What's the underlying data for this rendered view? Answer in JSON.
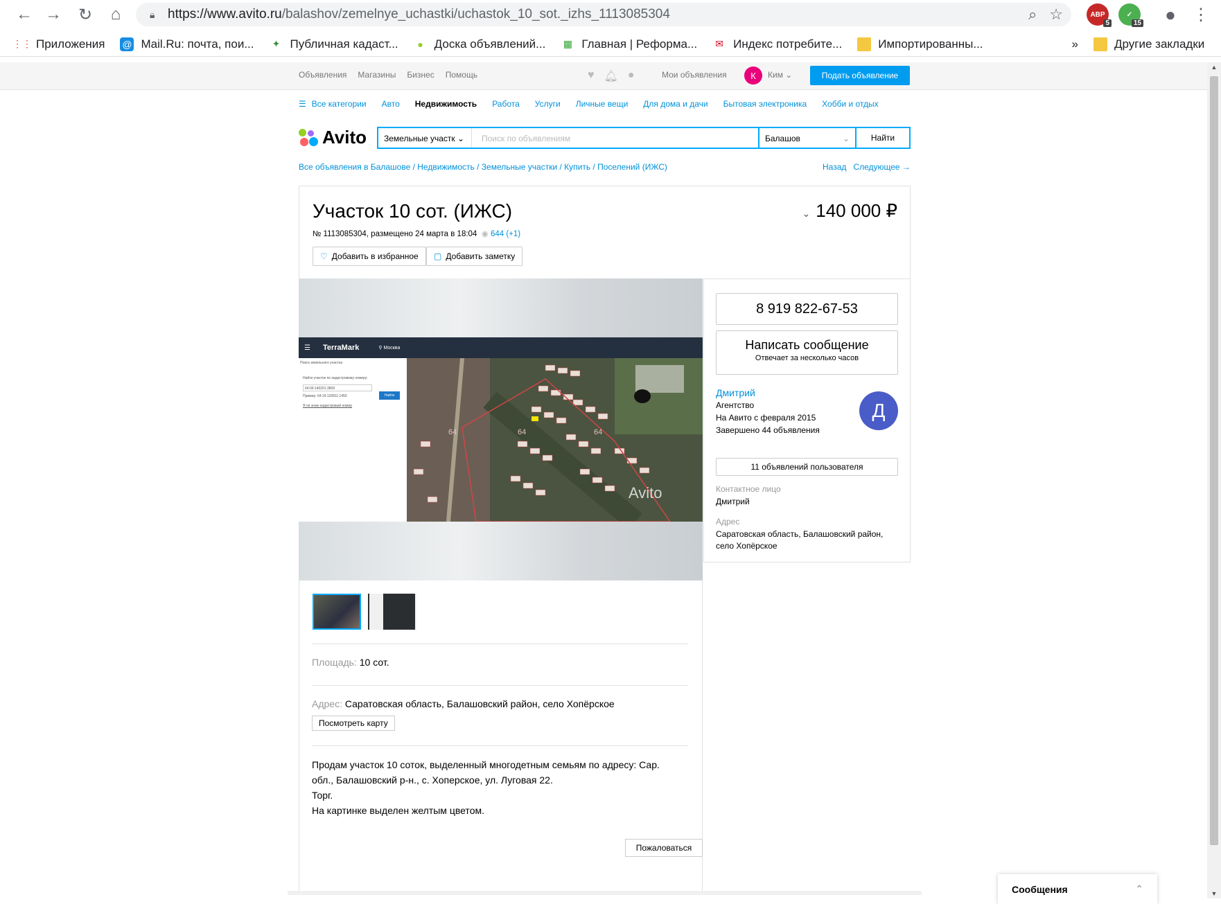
{
  "browser": {
    "url_host": "https://www.avito.ru",
    "url_path": "/balashov/zemelnye_uchastki/uchastok_10_sot._izhs_1113085304",
    "ext_abp_count": "5",
    "ext_other_count": "15",
    "bookmarks": [
      {
        "label": "Приложения",
        "icon": "apps-grid-icon",
        "color": "#ea4335"
      },
      {
        "label": "Mail.Ru: почта, пои...",
        "icon": "mailru-icon",
        "color": "#168de2"
      },
      {
        "label": "Публичная кадаст...",
        "icon": "pkk-icon",
        "color": "#3a8d3a"
      },
      {
        "label": "Доска объявлений...",
        "icon": "avito-icon",
        "color": "#97cf26"
      },
      {
        "label": "Главная | Реформа...",
        "icon": "reforma-icon",
        "color": "#2ea52e"
      },
      {
        "label": "Индекс потребите...",
        "icon": "index-icon",
        "color": "#d0021b"
      },
      {
        "label": "Импортированны...",
        "icon": "folder-icon",
        "color": "#f5c842"
      }
    ],
    "overflow": "»",
    "other_bookmarks": "Другие закладки"
  },
  "topbar": {
    "links": [
      "Объявления",
      "Магазины",
      "Бизнес",
      "Помощь"
    ],
    "my_ads": "Мои объявления",
    "avatar_letter": "К",
    "user_name": "Ким",
    "post_button": "Подать объявление"
  },
  "categories": {
    "all": "Все категории",
    "items": [
      "Авто",
      "Недвижимость",
      "Работа",
      "Услуги",
      "Личные вещи",
      "Для дома и дачи",
      "Бытовая электроника",
      "Хобби и отдых"
    ],
    "active": "Недвижимость"
  },
  "logo": "Avito",
  "search": {
    "category": "Земельные участк",
    "placeholder": "Поиск по объявлениям",
    "city": "Балашов",
    "button": "Найти"
  },
  "breadcrumbs": "Все объявления в Балашове / Недвижимость / Земельные участки / Купить / Поселений (ИЖС)",
  "pager": {
    "back": "Назад",
    "next": "Следующее →"
  },
  "listing": {
    "title": "Участок 10 сот. (ИЖС)",
    "meta": "№ 1113085304, размещено 24 марта в 18:04",
    "views": "644 (+1)",
    "price": "140 000 ₽",
    "fav_button": "Добавить в избранное",
    "note_button": "Добавить заметку",
    "map_app": {
      "brand": "TerraMark",
      "city": "Москва",
      "panel_title": "Поиск земельного участка",
      "panel_hint": "Найти участок по кадастровому номеру:",
      "cadastre_value": "64:06:140201:3809",
      "find": "Найти",
      "example": "Пример: 64:19:120811:1450",
      "link": "Я не знаю кадастровый номер",
      "parcel_label": "64",
      "watermark": "Avito"
    },
    "area_label": "Площадь:",
    "area_value": "10 сот.",
    "address_label": "Адрес:",
    "address_value": "Саратовская область, Балашовский район, село Хопёрское",
    "map_button": "Посмотреть карту",
    "description": [
      "Продам участок 10 соток, выделенный многодетным семьям по адресу: Сар.",
      "обл., Балашовский р-н., с. Хоперское, ул. Луговая 22.",
      "Торг.",
      "На картинке выделен желтым цветом."
    ],
    "complain": "Пожаловаться"
  },
  "seller": {
    "phone": "8 919 822-67-53",
    "write": "Написать сообщение",
    "reply": "Отвечает за несколько часов",
    "name": "Дмитрий",
    "type": "Агентство",
    "since": "На Авито с февраля 2015",
    "done": "Завершено 44 объявления",
    "avatar_letter": "Д",
    "ads_button": "11 объявлений пользователя",
    "contact_label": "Контактное лицо",
    "contact_value": "Дмитрий",
    "address_label": "Адрес",
    "address_value": "Саратовская область, Балашовский район, село Хопёрское"
  },
  "messages_bar": "Сообщения",
  "colors": {
    "accent": "#009cf0",
    "link": "#0091d9",
    "avatar_user": "#e9007a",
    "avatar_seller": "#4a5cc7"
  }
}
